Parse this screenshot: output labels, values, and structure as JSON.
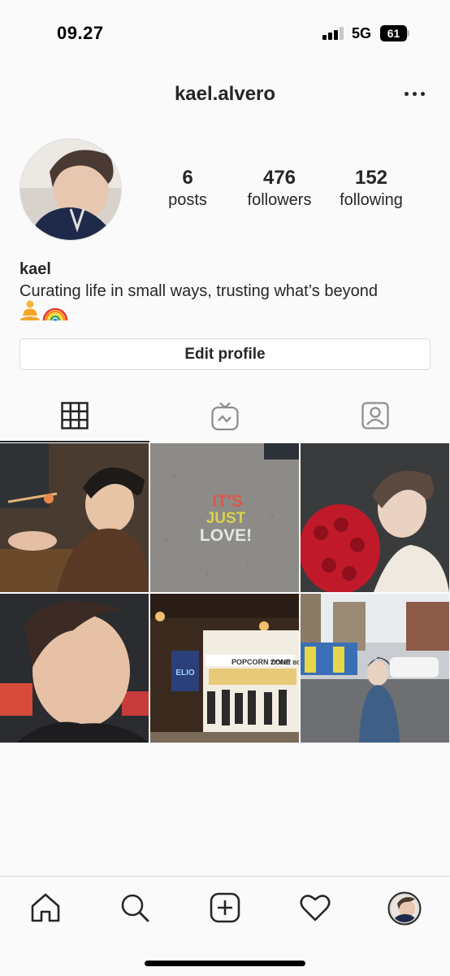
{
  "status_bar": {
    "time": "09.27",
    "network": "5G",
    "battery": "61"
  },
  "header": {
    "username": "kael.alvero",
    "more_icon": "more-horizontal-icon"
  },
  "profile": {
    "stats": {
      "posts": {
        "count": "6",
        "label": "posts"
      },
      "followers": {
        "count": "476",
        "label": "followers"
      },
      "following": {
        "count": "152",
        "label": "following"
      }
    },
    "name": "kael",
    "bio": "Curating life in small ways, trusting what’s beyond",
    "bio_emoji": [
      "meditating-person-icon",
      "rainbow-icon"
    ],
    "edit_button": "Edit profile"
  },
  "tabs": [
    {
      "icon": "grid-icon",
      "active": true
    },
    {
      "icon": "igtv-icon",
      "active": false
    },
    {
      "icon": "tagged-icon",
      "active": false
    }
  ],
  "posts": [
    {
      "text": ""
    },
    {
      "text": "IT'S JUST LOVE!"
    },
    {
      "text": ""
    },
    {
      "text": ""
    },
    {
      "text": "POPCORN ZONE",
      "text2": "TICKET BOX",
      "text3": "ELIO"
    },
    {
      "text": ""
    }
  ],
  "bottom_nav": [
    "home-icon",
    "search-icon",
    "new-post-icon",
    "activity-heart-icon",
    "profile-avatar-icon"
  ],
  "colors": {
    "text": "#262626",
    "border": "#dbdbdb",
    "background": "#fafafa"
  }
}
